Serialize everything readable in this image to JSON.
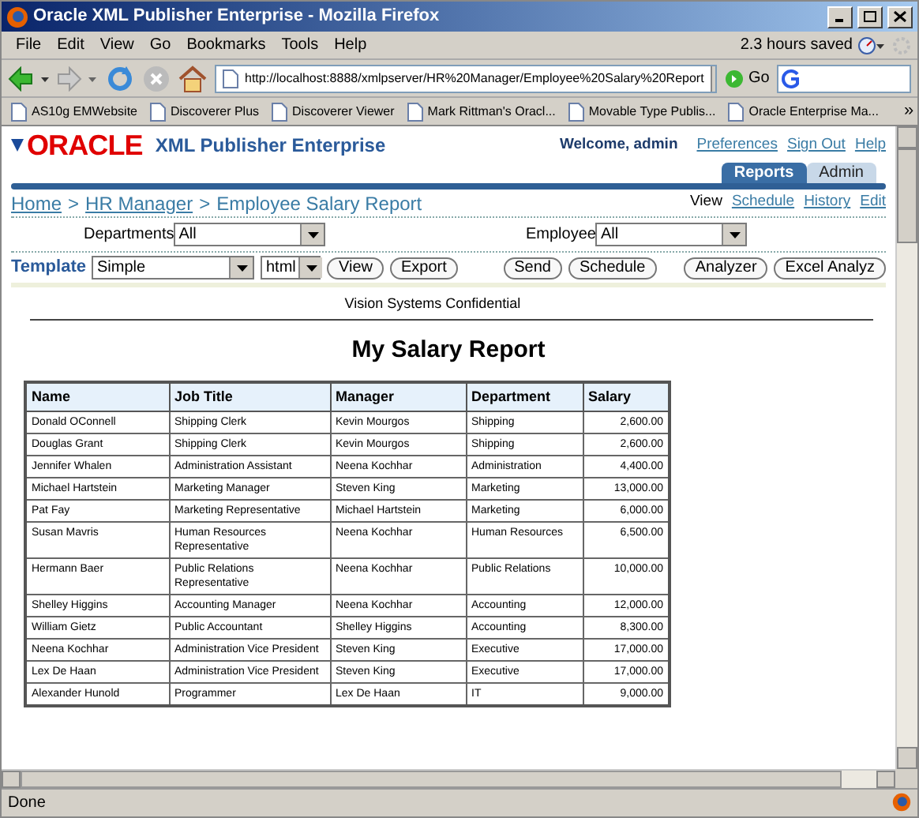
{
  "window": {
    "title": "Oracle XML Publisher Enterprise - Mozilla Firefox"
  },
  "menu": [
    "File",
    "Edit",
    "View",
    "Go",
    "Bookmarks",
    "Tools",
    "Help"
  ],
  "time_saved": "2.3 hours saved",
  "toolbar": {
    "url": "http://localhost:8888/xmlpserver/HR%20Manager/Employee%20Salary%20Report",
    "go": "Go"
  },
  "bookmarks": [
    "AS10g EMWebsite",
    "Discoverer Plus",
    "Discoverer Viewer",
    "Mark Rittman's Oracl...",
    "Movable Type Publis...",
    "Oracle Enterprise Ma..."
  ],
  "bookmarks_more": "»",
  "app": {
    "logo": "ORACLE",
    "product": "XML Publisher Enterprise",
    "welcome": "Welcome, admin",
    "links": [
      "Preferences",
      "Sign Out",
      "Help"
    ],
    "tabs": [
      {
        "label": "Reports",
        "selected": true
      },
      {
        "label": "Admin",
        "selected": false
      }
    ],
    "breadcrumb": [
      {
        "kind": "link",
        "label": "Home"
      },
      {
        "kind": "separator",
        "label": ">"
      },
      {
        "kind": "link",
        "label": "HR Manager"
      },
      {
        "kind": "separator",
        "label": ">"
      },
      {
        "kind": "current",
        "label": "Employee Salary Report"
      }
    ],
    "view_links": [
      {
        "label": "View",
        "selected": true
      },
      {
        "label": "Schedule",
        "selected": false
      },
      {
        "label": "History",
        "selected": false
      },
      {
        "label": "Edit",
        "selected": false
      }
    ],
    "parameters": [
      {
        "label": "Departments",
        "value": "All"
      },
      {
        "label": "Employee",
        "value": "All"
      }
    ],
    "template": {
      "label": "Template",
      "value": "Simple",
      "format": "html"
    },
    "buttons": [
      "View",
      "Export",
      "Send",
      "Schedule",
      "Analyzer",
      "Excel Analyz"
    ]
  },
  "report": {
    "confidential": "Vision Systems Confidential",
    "title": "My Salary Report",
    "columns": [
      "Name",
      "Job Title",
      "Manager",
      "Department",
      "Salary"
    ],
    "rows": [
      [
        "Donald OConnell",
        "Shipping Clerk",
        "Kevin Mourgos",
        "Shipping",
        "2,600.00"
      ],
      [
        "Douglas Grant",
        "Shipping Clerk",
        "Kevin Mourgos",
        "Shipping",
        "2,600.00"
      ],
      [
        "Jennifer Whalen",
        "Administration Assistant",
        "Neena Kochhar",
        "Administration",
        "4,400.00"
      ],
      [
        "Michael Hartstein",
        "Marketing Manager",
        "Steven King",
        "Marketing",
        "13,000.00"
      ],
      [
        "Pat Fay",
        "Marketing Representative",
        "Michael Hartstein",
        "Marketing",
        "6,000.00"
      ],
      [
        "Susan Mavris",
        "Human Resources Representative",
        "Neena Kochhar",
        "Human Resources",
        "6,500.00"
      ],
      [
        "Hermann Baer",
        "Public Relations Representative",
        "Neena Kochhar",
        "Public Relations",
        "10,000.00"
      ],
      [
        "Shelley Higgins",
        "Accounting Manager",
        "Neena Kochhar",
        "Accounting",
        "12,000.00"
      ],
      [
        "William Gietz",
        "Public Accountant",
        "Shelley Higgins",
        "Accounting",
        "8,300.00"
      ],
      [
        "Neena Kochhar",
        "Administration Vice President",
        "Steven King",
        "Executive",
        "17,000.00"
      ],
      [
        "Lex De Haan",
        "Administration Vice President",
        "Steven King",
        "Executive",
        "17,000.00"
      ],
      [
        "Alexander Hunold",
        "Programmer",
        "Lex De Haan",
        "IT",
        "9,000.00"
      ]
    ]
  },
  "status_bar": "Done"
}
